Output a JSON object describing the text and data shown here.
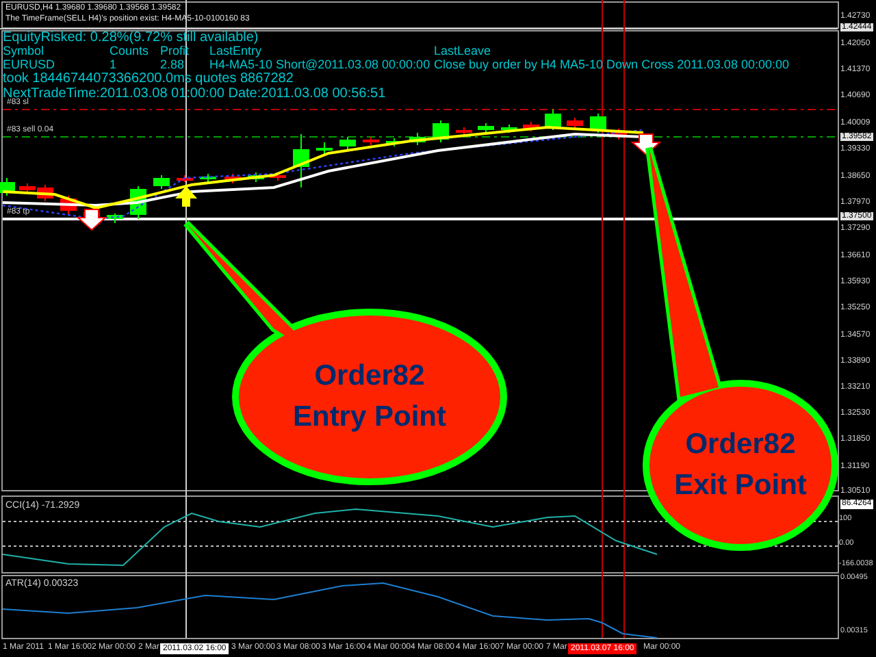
{
  "chart_header": {
    "symbol_line": "EURUSD,H4  1.39680 1.39680 1.39568 1.39582",
    "timeframe_line": "The TimeFrame(SELL H4)'s position exist: H4-MA5-10-0100160 83"
  },
  "info_panel": {
    "equity": "EquityRisked: 0.28%(9.72% still available)",
    "columns": [
      "Symbol",
      "Counts",
      "Profit",
      "LastEntry",
      "LastLeave"
    ],
    "row": [
      "EURUSD",
      "1",
      "2.88",
      "H4-MA5-10 Short@2011.03.08 00:00:00",
      "Close buy order by H4  MA5-10  Down Cross  2011.03.08 00:00:00"
    ],
    "took": "took 18446744073366200.0ms quotes 8867282",
    "next_trade": "NextTradeTime:2011.03.08 01:00:00 Date:2011.03.08 00:56:51"
  },
  "order_lines": [
    {
      "kind": "sl",
      "label": "#83 sl"
    },
    {
      "kind": "entry",
      "label": "#83 sell 0.04"
    },
    {
      "kind": "tp",
      "label": "#83 tp"
    }
  ],
  "price_axis": [
    {
      "text": "1.42730",
      "kind": "tick"
    },
    {
      "text": "1.42444",
      "kind": "marker"
    },
    {
      "text": "1.42050",
      "kind": "tick"
    },
    {
      "text": "1.41370",
      "kind": "tick"
    },
    {
      "text": "1.40690",
      "kind": "tick"
    },
    {
      "text": "1.40009",
      "kind": "tick"
    },
    {
      "text": "1.39582",
      "kind": "marker"
    },
    {
      "text": "1.39330",
      "kind": "tick"
    },
    {
      "text": "1.38650",
      "kind": "tick"
    },
    {
      "text": "1.37970",
      "kind": "tick"
    },
    {
      "text": "1.37500",
      "kind": "marker"
    },
    {
      "text": "1.37290",
      "kind": "tick"
    },
    {
      "text": "1.36610",
      "kind": "tick"
    },
    {
      "text": "1.35930",
      "kind": "tick"
    },
    {
      "text": "1.35250",
      "kind": "tick"
    },
    {
      "text": "1.34570",
      "kind": "tick"
    },
    {
      "text": "1.33890",
      "kind": "tick"
    },
    {
      "text": "1.33210",
      "kind": "tick"
    },
    {
      "text": "1.32530",
      "kind": "tick"
    },
    {
      "text": "1.31850",
      "kind": "tick"
    },
    {
      "text": "1.31190",
      "kind": "tick"
    },
    {
      "text": "1.30510",
      "kind": "tick"
    }
  ],
  "cci_pane": {
    "label": "CCI(14) -71.2929",
    "axis": [
      {
        "text": "86.4264",
        "kind": "marker"
      },
      {
        "text": "100",
        "kind": "tick"
      },
      {
        "text": "0.00",
        "kind": "tick"
      },
      {
        "text": "-166.0038",
        "kind": "tick"
      }
    ]
  },
  "atr_pane": {
    "label": "ATR(14) 0.00323",
    "axis": [
      "0.00495",
      "0.00315"
    ]
  },
  "time_axis": [
    {
      "text": "1 Mar 2011",
      "kind": "tick"
    },
    {
      "text": "1 Mar 16:00",
      "kind": "tick"
    },
    {
      "text": "2 Mar 00:00",
      "kind": "tick"
    },
    {
      "text": "2 Mar",
      "kind": "tick"
    },
    {
      "text": "2011.03.02 16:00",
      "kind": "marker"
    },
    {
      "text": "3 Mar 00:00",
      "kind": "tick"
    },
    {
      "text": "3 Mar 08:00",
      "kind": "tick"
    },
    {
      "text": "3 Mar 16:00",
      "kind": "tick"
    },
    {
      "text": "4 Mar 00:00",
      "kind": "tick"
    },
    {
      "text": "4 Mar 08:00",
      "kind": "tick"
    },
    {
      "text": "4 Mar 16:00",
      "kind": "tick"
    },
    {
      "text": "7 Mar 00:00",
      "kind": "tick"
    },
    {
      "text": "7 Mar",
      "kind": "tick"
    },
    {
      "text": "2011.03.07 16:00",
      "kind": "alert"
    },
    {
      "text": "Mar 00:00",
      "kind": "tick"
    }
  ],
  "callouts": [
    {
      "title": "Order82",
      "subtitle": "Entry Point"
    },
    {
      "title": "Order82",
      "subtitle": "Exit Point"
    }
  ]
}
